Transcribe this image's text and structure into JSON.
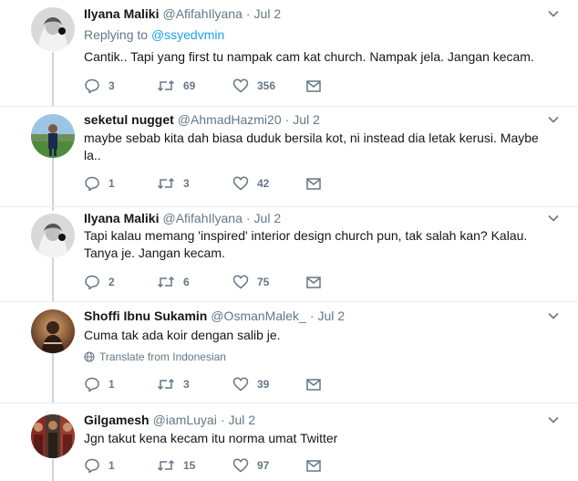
{
  "tweets": [
    {
      "name": "Ilyana Maliki",
      "handle": "@AfifahIlyana",
      "time": "Jul 2",
      "replying_label": "Replying to",
      "replying_to": "@ssyedvmin",
      "text": "Cantik.. Tapi yang first tu nampak cam kat church. Nampak jela. Jangan kecam.",
      "replies": "3",
      "retweets": "69",
      "likes": "356",
      "avatar": "avatar-hijab"
    },
    {
      "name": "seketul nugget",
      "handle": "@AhmadHazmi20",
      "time": "Jul 2",
      "text": "maybe sebab kita dah biasa duduk bersila kot, ni instead dia letak kerusi. Maybe la..",
      "replies": "1",
      "retweets": "3",
      "likes": "42",
      "avatar": "avatar-field"
    },
    {
      "name": "Ilyana Maliki",
      "handle": "@AfifahIlyana",
      "time": "Jul 2",
      "text": "Tapi kalau memang 'inspired' interior design church pun, tak salah kan? Kalau. Tanya je. Jangan kecam.",
      "replies": "2",
      "retweets": "6",
      "likes": "75",
      "avatar": "avatar-hijab"
    },
    {
      "name": "Shoffi Ibnu Sukamin",
      "handle": "@OsmanMalek_",
      "time": "Jul 2",
      "text": "Cuma tak ada koir dengan salib je.",
      "translate": "Translate from Indonesian",
      "replies": "1",
      "retweets": "3",
      "likes": "39",
      "avatar": "avatar-warm"
    },
    {
      "name": "Gilgamesh",
      "handle": "@iamLuyai",
      "time": "Jul 2",
      "text": "Jgn takut kena kecam itu norma umat Twitter",
      "replies": "1",
      "retweets": "15",
      "likes": "97",
      "avatar": "avatar-group"
    }
  ],
  "separator": "·",
  "colors": {
    "text": "#14171a",
    "muted": "#657786",
    "link": "#1da1f2",
    "thread_line": "#ccd6dd",
    "divider": "#e6ecf0"
  }
}
